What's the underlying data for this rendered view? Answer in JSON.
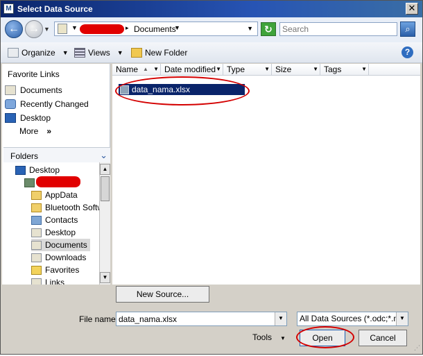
{
  "window": {
    "title": "Select Data Source",
    "close": "✕"
  },
  "nav": {
    "back": "←",
    "forward": "→"
  },
  "address": {
    "crumb": "Documents"
  },
  "search": {
    "placeholder": "Search"
  },
  "toolbar": {
    "organize": "Organize",
    "views": "Views",
    "new_folder": "New Folder"
  },
  "favorites": {
    "header": "Favorite Links",
    "items": [
      "Documents",
      "Recently Changed",
      "Desktop"
    ],
    "more": "More",
    "more_chevron": "»"
  },
  "folders": {
    "title": "Folders",
    "tree": [
      "Desktop",
      "AppData",
      "Bluetooth Software",
      "Contacts",
      "Desktop",
      "Documents",
      "Downloads",
      "Favorites",
      "Links"
    ]
  },
  "columns": [
    "Name",
    "Date modified",
    "Type",
    "Size",
    "Tags"
  ],
  "files": [
    {
      "name": "data_nama.xlsx",
      "selected": true
    }
  ],
  "bottom": {
    "new_source": "New Source...",
    "file_name_label": "File name:",
    "file_name_value": "data_nama.xlsx",
    "filter": "All Data Sources (*.odc;*.mdb",
    "tools": "Tools",
    "open": "Open",
    "cancel": "Cancel"
  },
  "colors": {
    "title_bar": "#0a246a",
    "selection": "#0a246a",
    "annotation": "#d40000"
  }
}
